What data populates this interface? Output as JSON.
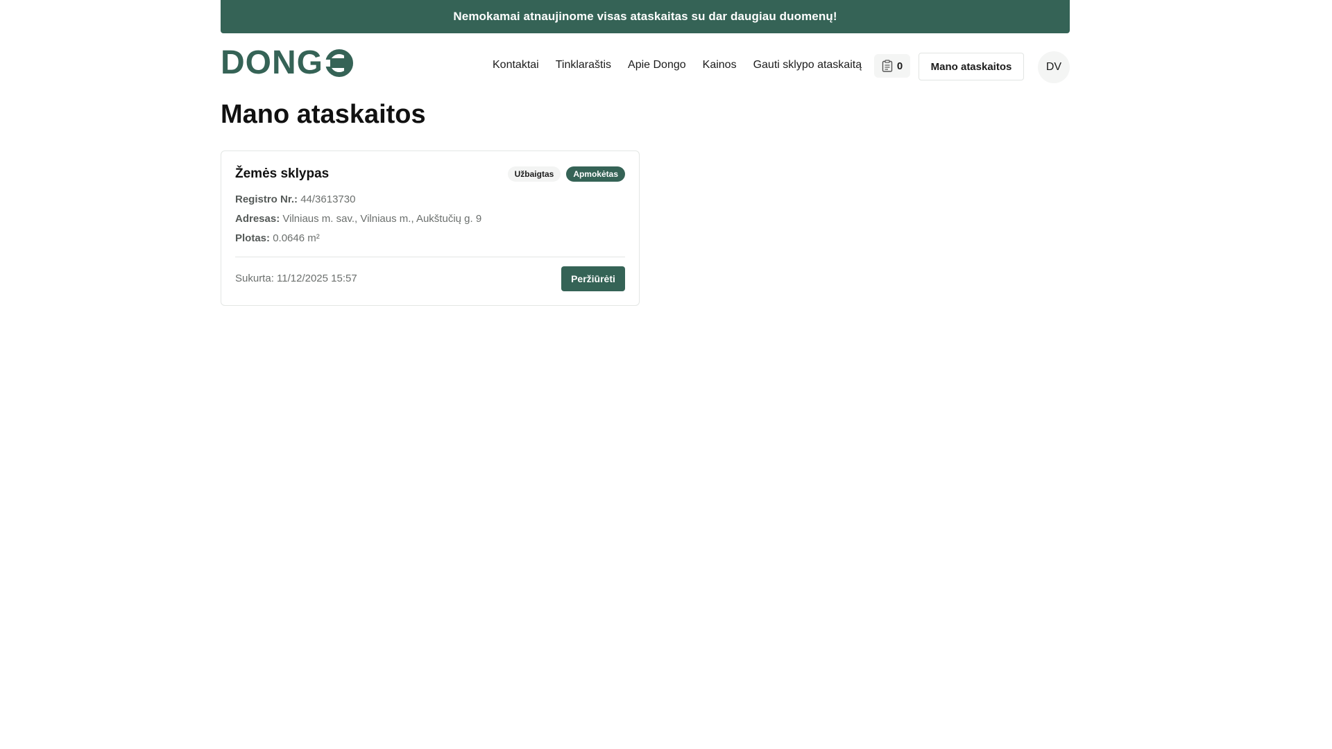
{
  "banner": {
    "text": "Nemokamai atnaujinome visas ataskaitas su dar daugiau duomenų!"
  },
  "header": {
    "logo_text": "DONG",
    "nav": [
      "Kontaktai",
      "Tinklaraštis",
      "Apie Dongo",
      "Kainos",
      "Gauti sklypo ataskaitą"
    ],
    "cart_count": "0",
    "reports_button": "Mano ataskaitos",
    "avatar_initials": "DV"
  },
  "main": {
    "title": "Mano ataskaitos",
    "reports": [
      {
        "title": "Žemės sklypas",
        "badges": [
          "Užbaigtas",
          "Apmokėtas"
        ],
        "registry_label": "Registro Nr.:",
        "registry_value": "44/3613730",
        "address_label": "Adresas:",
        "address_value": "Vilniaus m. sav., Vilniaus m., Aukštučių g. 9",
        "area_label": "Plotas:",
        "area_value": "0.0646 m²",
        "created": "Sukurta: 11/12/2025 15:57",
        "view_button": "Peržiūrėti"
      }
    ]
  },
  "colors": {
    "brand": "#356356",
    "border": "#e3e6e4",
    "muted_text": "#6b6f6d"
  },
  "icons": {
    "logo_mark": "arrow-circle-icon",
    "cart": "clipboard-icon"
  }
}
